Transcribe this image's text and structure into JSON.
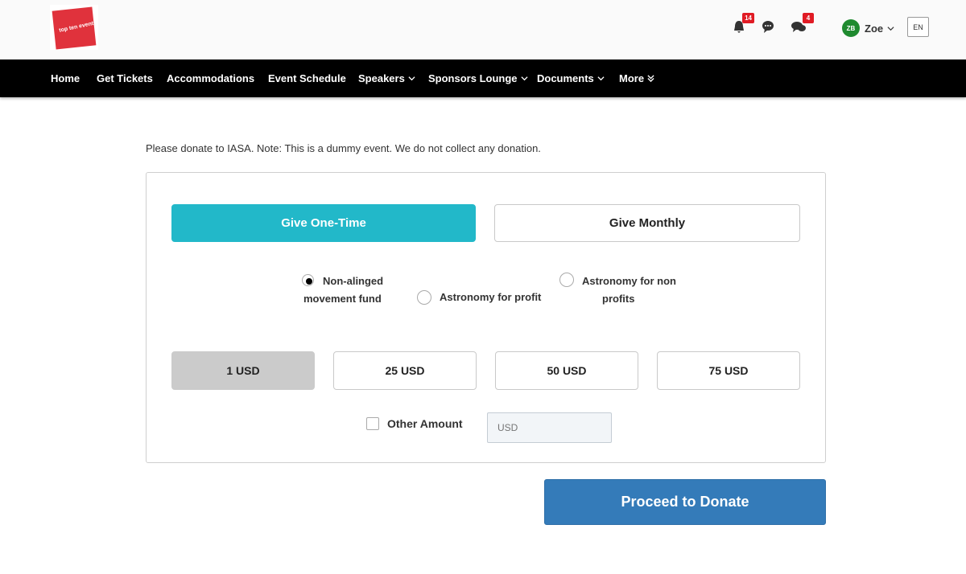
{
  "header": {
    "logo_text": "top ten events",
    "icons": [
      {
        "name": "bell-icon",
        "badge": "14"
      },
      {
        "name": "chat-icon",
        "badge": ""
      },
      {
        "name": "messages-icon",
        "badge": "4"
      }
    ],
    "user": {
      "initials": "ZB",
      "name": "Zoe"
    },
    "language": "EN"
  },
  "nav": {
    "items": [
      {
        "label": "Home",
        "dropdown": false
      },
      {
        "label": "Get Tickets",
        "dropdown": false
      },
      {
        "label": "Accommodations",
        "dropdown": false
      },
      {
        "label": "Event Schedule",
        "dropdown": false
      },
      {
        "label": "Speakers",
        "dropdown": true
      },
      {
        "label": "Sponsors Lounge",
        "dropdown": true
      },
      {
        "label": "Documents",
        "dropdown": true
      },
      {
        "label": "More",
        "dropdown": true,
        "icon": "double-chevron-down-icon"
      }
    ]
  },
  "donation": {
    "note": "Please donate to IASA. Note: This is a dummy event. We do not collect any donation.",
    "frequency": {
      "one_time_label": "Give One-Time",
      "monthly_label": "Give Monthly",
      "selected": "one_time"
    },
    "funds": [
      {
        "line1": "Non-alinged",
        "line2": "movement fund",
        "checked": true
      },
      {
        "line1": "Astronomy for profit",
        "line2": "",
        "checked": false
      },
      {
        "line1": "Astronomy for non",
        "line2": "profits",
        "checked": false
      }
    ],
    "amounts": [
      {
        "label": "1 USD",
        "selected": true
      },
      {
        "label": "25 USD",
        "selected": false
      },
      {
        "label": "50 USD",
        "selected": false
      },
      {
        "label": "75 USD",
        "selected": false
      }
    ],
    "other_amount_label": "Other Amount",
    "other_amount_placeholder": "USD",
    "other_amount_value": "",
    "proceed_label": "Proceed to Donate"
  },
  "colors": {
    "accent_teal": "#22b8c9",
    "primary_blue": "#347bb9",
    "nav_bg": "#000000",
    "logo_red": "#e0323c",
    "avatar_green": "#1f8a2f",
    "badge_red": "#e01b24"
  }
}
